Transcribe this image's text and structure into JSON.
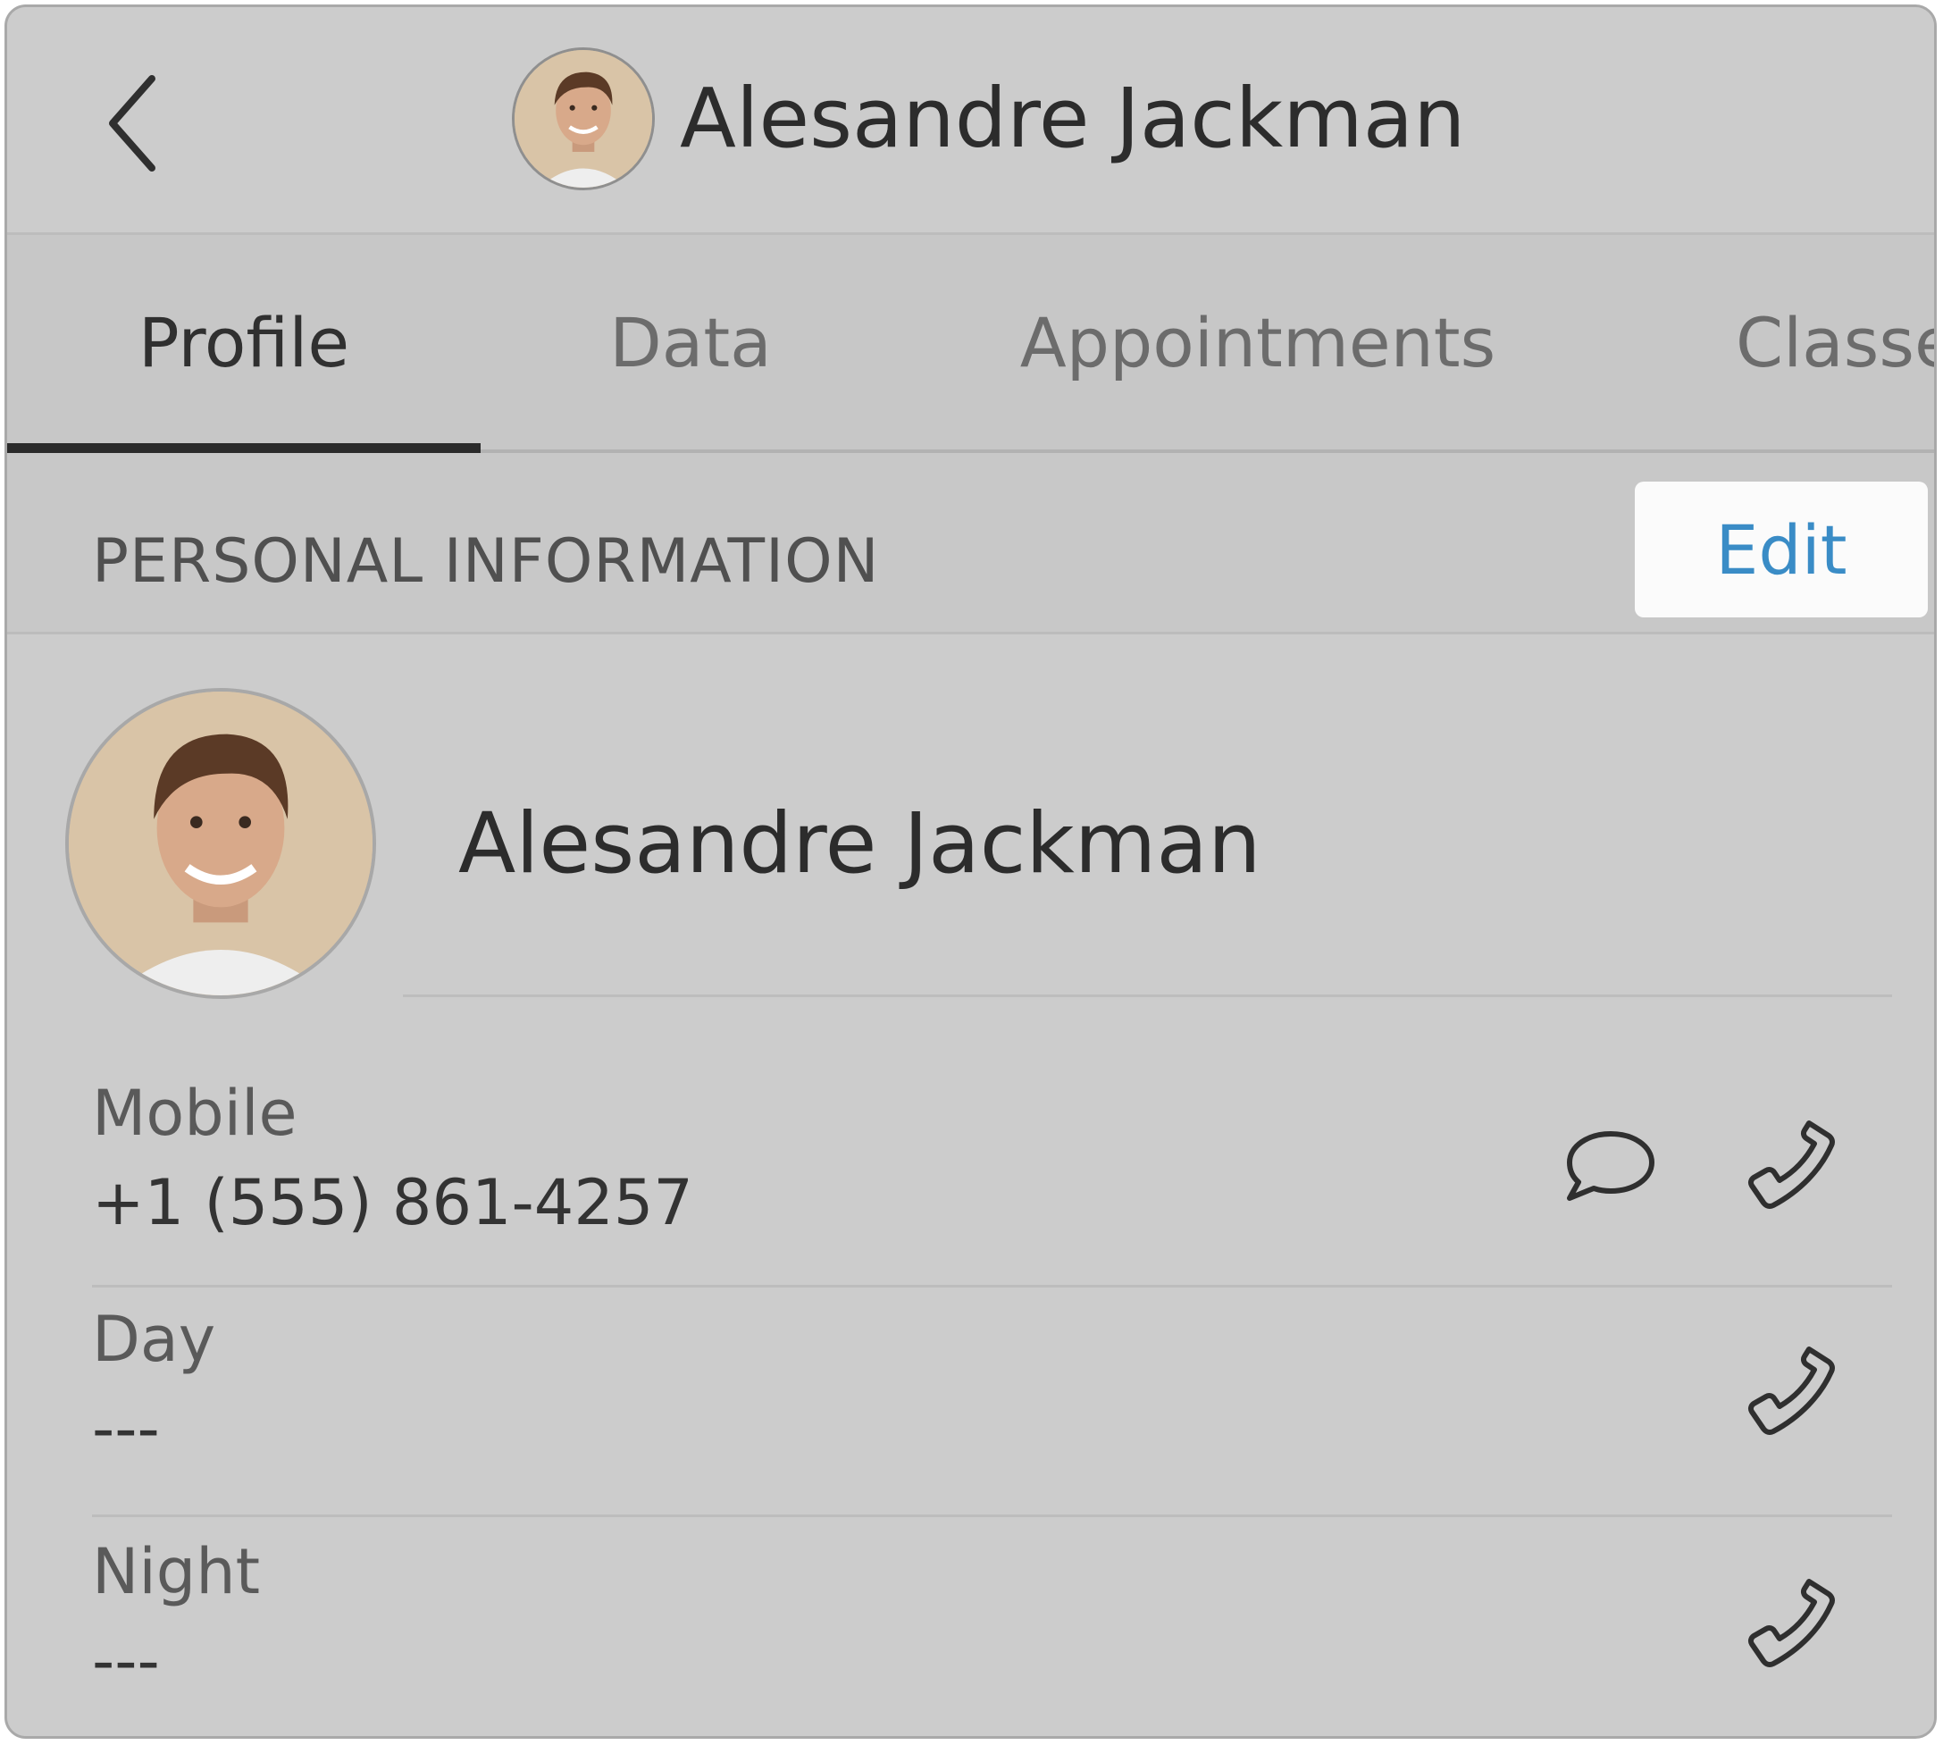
{
  "header": {
    "title": "Alesandre Jackman",
    "back_icon": "chevron-left-icon",
    "avatar_icon": "avatar"
  },
  "tabs": [
    {
      "label": "Profile",
      "active": true
    },
    {
      "label": "Data",
      "active": false
    },
    {
      "label": "Appointments",
      "active": false
    },
    {
      "label": "Classe",
      "active": false
    }
  ],
  "section": {
    "title": "PERSONAL INFORMATION",
    "edit_label": "Edit"
  },
  "profile": {
    "name": "Alesandre Jackman"
  },
  "phones": [
    {
      "label": "Mobile",
      "value": "+1 (555) 861-4257",
      "icons": [
        "chat-bubble-icon",
        "phone-icon"
      ]
    },
    {
      "label": "Day",
      "value": "---",
      "icons": [
        "phone-icon"
      ]
    },
    {
      "label": "Night",
      "value": "---",
      "icons": [
        "phone-icon"
      ]
    }
  ],
  "colors": {
    "accent": "#3a8cc6",
    "background": "#cccccc",
    "text": "#2c2c2c"
  }
}
